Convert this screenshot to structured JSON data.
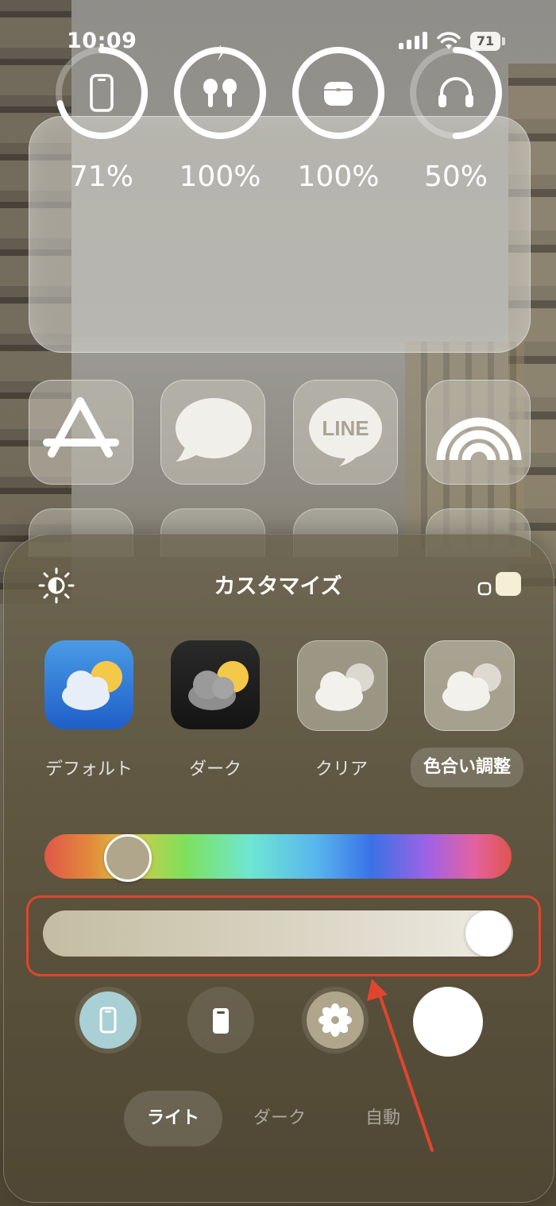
{
  "status_bar": {
    "time": "10:09",
    "battery_level": "71"
  },
  "battery_widget": {
    "devices": [
      {
        "icon": "iphone-icon",
        "percent": "71%",
        "level": 0.71
      },
      {
        "icon": "airpods-icon",
        "percent": "100%",
        "level": 1.0
      },
      {
        "icon": "airpods-case-icon",
        "percent": "100%",
        "level": 1.0
      },
      {
        "icon": "headphones-icon",
        "percent": "50%",
        "level": 0.5
      }
    ]
  },
  "apps": [
    {
      "name": "App Store",
      "icon": "app-store-icon"
    },
    {
      "name": "Messages",
      "icon": "messages-icon"
    },
    {
      "name": "LINE",
      "icon": "line-icon",
      "label": "LINE"
    },
    {
      "name": "Arc",
      "icon": "rainbow-arcs-icon"
    }
  ],
  "customize": {
    "title": "カスタマイズ",
    "styles": [
      {
        "label": "デフォルト",
        "icon": "weather-default-icon"
      },
      {
        "label": "ダーク",
        "icon": "weather-dark-icon"
      },
      {
        "label": "クリア",
        "icon": "weather-clear-icon"
      },
      {
        "label": "色合い調整",
        "icon": "weather-tint-icon",
        "selected": true
      }
    ],
    "hue_slider": {
      "value": 0.08,
      "color": "#b0a68c"
    },
    "saturation_slider": {
      "value": 1.0
    },
    "appearance": {
      "options": [
        "ライト",
        "ダーク",
        "自動"
      ],
      "selected": "ライト"
    }
  },
  "colors": {
    "highlight": "#e0452e",
    "accent_tint": "#b0a68c",
    "phone_button": "#a9d0d4"
  }
}
